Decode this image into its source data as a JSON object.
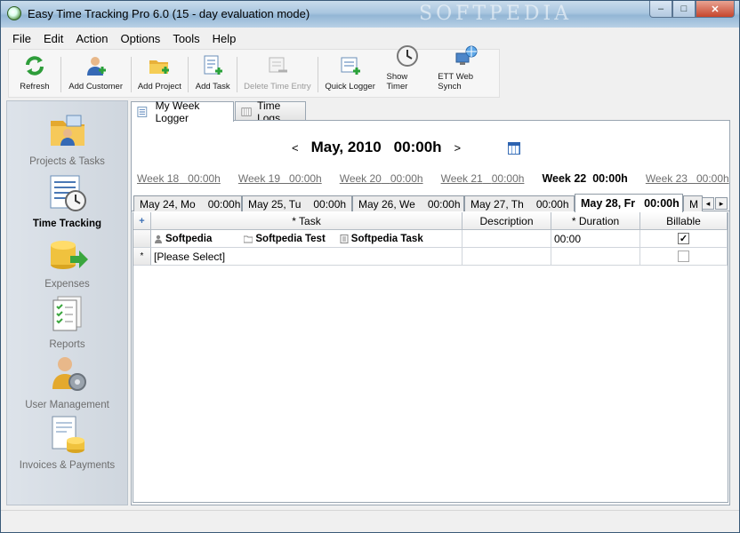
{
  "window": {
    "title": "Easy Time Tracking Pro 6.0 (15 - day evaluation mode)",
    "watermark": "SOFTPEDIA",
    "minimize_label": "–",
    "maximize_label": "□",
    "close_label": "✕"
  },
  "menu": [
    "File",
    "Edit",
    "Action",
    "Options",
    "Tools",
    "Help"
  ],
  "toolbar": [
    {
      "label": "Refresh",
      "icon": "refresh-icon",
      "enabled": true
    },
    {
      "label": "Add Customer",
      "icon": "add-customer-icon",
      "enabled": true
    },
    {
      "label": "Add Project",
      "icon": "add-project-icon",
      "enabled": true
    },
    {
      "label": "Add Task",
      "icon": "add-task-icon",
      "enabled": true
    },
    {
      "label": "Delete Time Entry",
      "icon": "delete-entry-icon",
      "enabled": false
    },
    {
      "label": "Quick Logger",
      "icon": "quick-logger-icon",
      "enabled": true
    },
    {
      "label": "Show Timer",
      "icon": "clock-icon",
      "enabled": true
    },
    {
      "label": "ETT Web Synch",
      "icon": "web-synch-icon",
      "enabled": true
    }
  ],
  "sidebar": [
    {
      "label": "Projects & Tasks",
      "icon": "projects-folder-icon",
      "active": false
    },
    {
      "label": "Time Tracking",
      "icon": "time-tracking-icon",
      "active": true
    },
    {
      "label": "Expenses",
      "icon": "expenses-coins-icon",
      "active": false
    },
    {
      "label": "Reports",
      "icon": "reports-icon",
      "active": false
    },
    {
      "label": "User Management",
      "icon": "user-management-icon",
      "active": false
    },
    {
      "label": "Invoices & Payments",
      "icon": "invoices-icon",
      "active": false
    }
  ],
  "tabs": [
    {
      "label": "My Week Logger",
      "active": true
    },
    {
      "label": "Time Logs",
      "active": false
    }
  ],
  "logger": {
    "prev_arrow": "<",
    "next_arrow": ">",
    "month": "May, 2010",
    "total": "00:00h",
    "weeks": [
      {
        "label": "Week 18",
        "time": "00:00h",
        "current": false
      },
      {
        "label": "Week 19",
        "time": "00:00h",
        "current": false
      },
      {
        "label": "Week 20",
        "time": "00:00h",
        "current": false
      },
      {
        "label": "Week 21",
        "time": "00:00h",
        "current": false
      },
      {
        "label": "Week 22",
        "time": "00:00h",
        "current": true
      },
      {
        "label": "Week 23",
        "time": "00:00h",
        "current": false
      }
    ],
    "days": [
      {
        "label": "May 24, Mo",
        "time": "00:00h",
        "active": false
      },
      {
        "label": "May 25, Tu",
        "time": "00:00h",
        "active": false
      },
      {
        "label": "May 26, We",
        "time": "00:00h",
        "active": false
      },
      {
        "label": "May 27, Th",
        "time": "00:00h",
        "active": false
      },
      {
        "label": "May 28, Fr",
        "time": "00:00h",
        "active": true
      },
      {
        "label": "M",
        "time": "",
        "active": false
      }
    ],
    "scroll_left": "◂",
    "scroll_right": "▸"
  },
  "grid": {
    "columns": {
      "task": "* Task",
      "description": "Description",
      "duration": "* Duration",
      "billable": "Billable"
    },
    "rows": [
      {
        "customer": "Softpedia",
        "project": "Softpedia Test",
        "task": "Softpedia Task",
        "description": "",
        "duration": "00:00",
        "billable": true
      }
    ],
    "new_row": {
      "marker": "*",
      "task": "[Please Select]",
      "billable": false
    },
    "corner_glyph": "+"
  }
}
